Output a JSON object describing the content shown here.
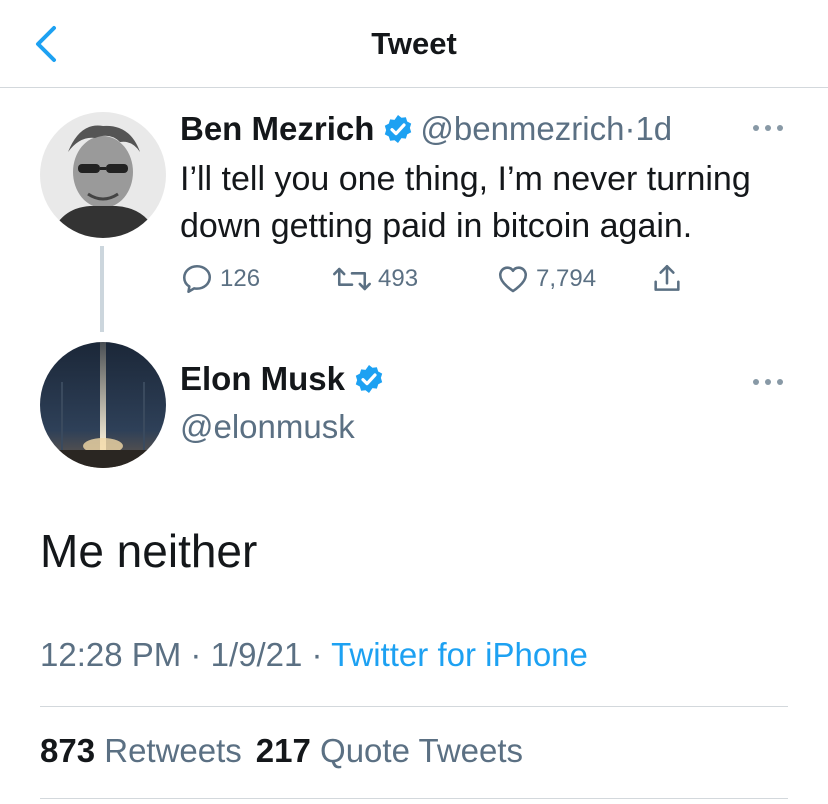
{
  "header": {
    "title": "Tweet",
    "back_icon": "chevron-left-icon"
  },
  "colors": {
    "accent": "#1da1f2",
    "secondary_text": "#5b7083",
    "primary_text": "#14171a",
    "divider": "#d3d8dc"
  },
  "parent_tweet": {
    "author_name": "Ben Mezrich",
    "handle": "@benmezrich",
    "separator": "·",
    "time": "1d",
    "verified": true,
    "text": "I’ll tell you one thing, I’m never turning down getting paid in bitcoin again.",
    "replies": "126",
    "retweets": "493",
    "likes": "7,794"
  },
  "main_tweet": {
    "author_name": "Elon Musk",
    "handle": "@elonmusk",
    "verified": true,
    "text": "Me neither",
    "time": "12:28 PM",
    "date": "1/9/21",
    "sep1": "·",
    "sep2": "·",
    "source": "Twitter for iPhone",
    "retweet_count": "873",
    "retweet_label": "Retweets",
    "quote_count": "217",
    "quote_label": "Quote Tweets"
  }
}
